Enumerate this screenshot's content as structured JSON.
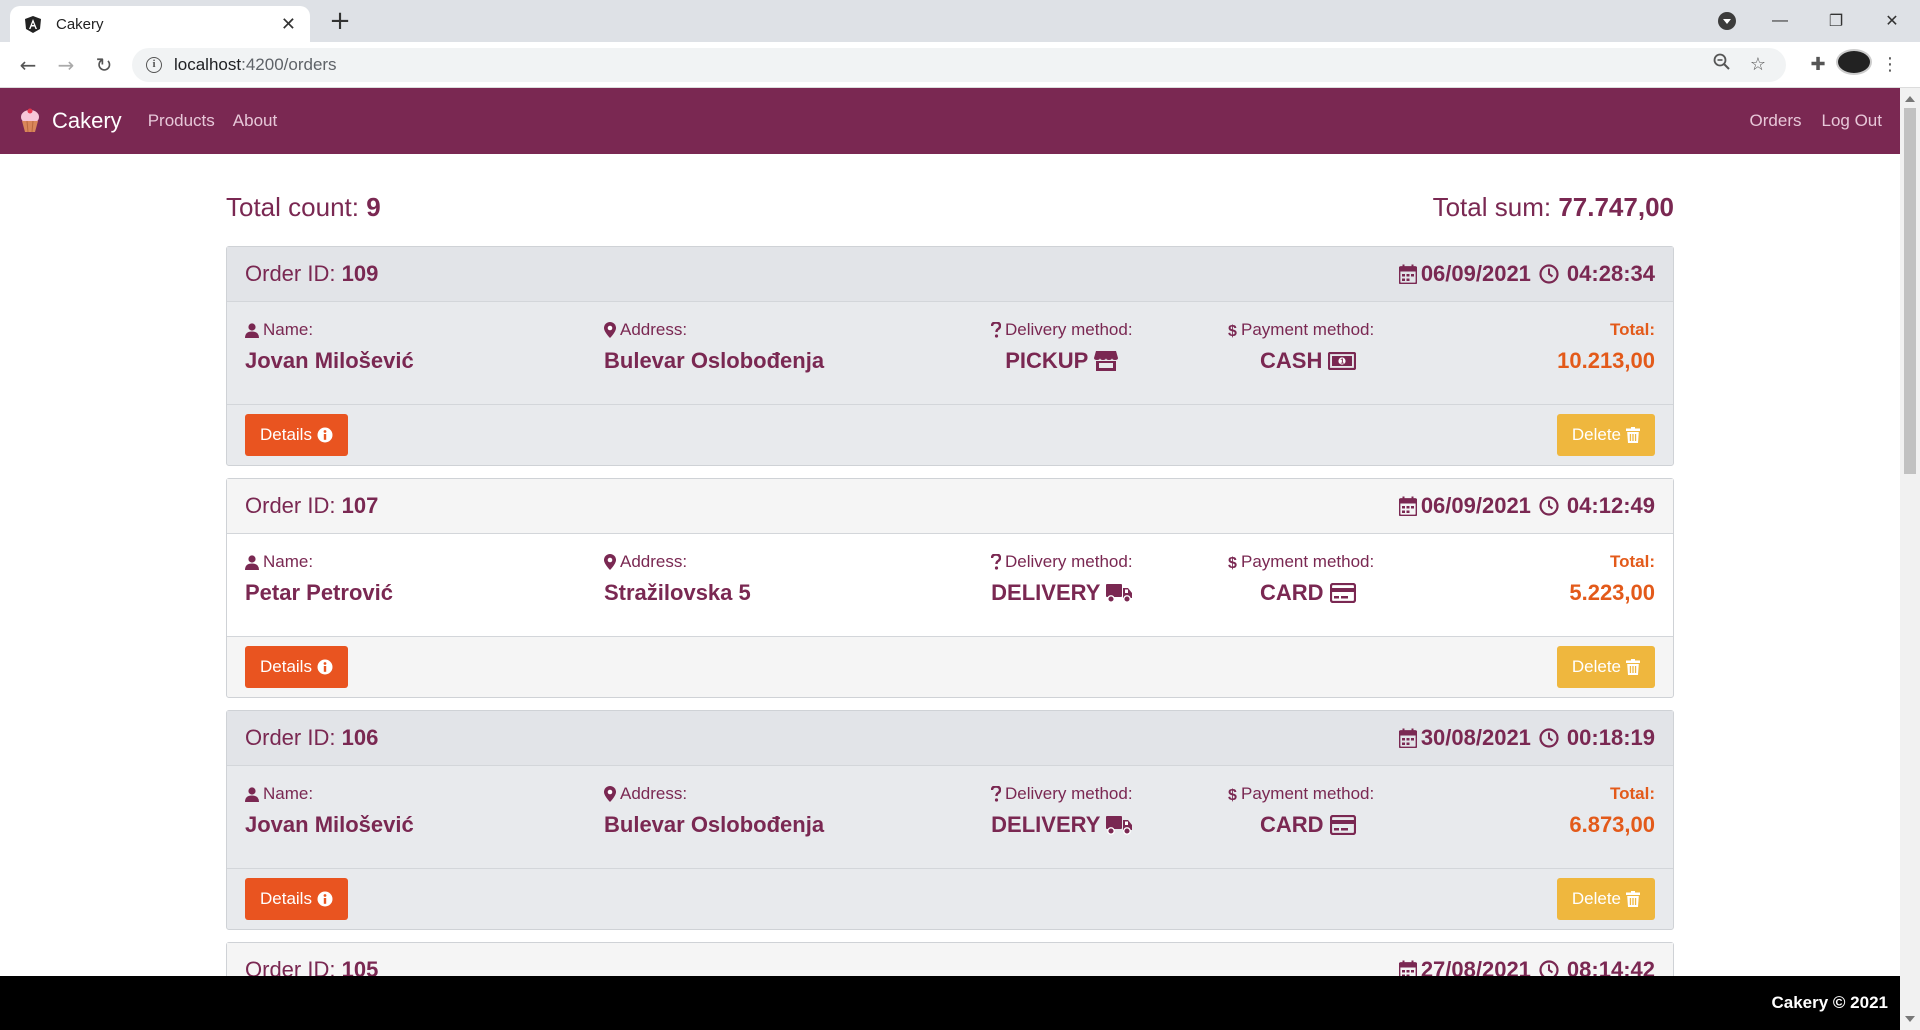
{
  "browser": {
    "tab_title": "Cakery",
    "url_host": "localhost",
    "url_rest": ":4200/orders",
    "new_tab": "+",
    "close": "✕"
  },
  "navbar": {
    "brand": "Cakery",
    "left_links": [
      "Products",
      "About"
    ],
    "right_links": [
      "Orders",
      "Log Out"
    ],
    "color": "#7a2852"
  },
  "summary": {
    "count_label": "Total count:",
    "count_value": "9",
    "sum_label": "Total sum:",
    "sum_value": "77.747,00"
  },
  "labels": {
    "order_id": "Order ID:",
    "name": "Name:",
    "address": "Address:",
    "delivery": "Delivery method:",
    "payment": "Payment method:",
    "total": "Total:",
    "details": "Details",
    "delete": "Delete"
  },
  "orders": [
    {
      "id": "109",
      "date": "06/09/2021",
      "time": "04:28:34",
      "name": "Jovan Milošević",
      "address": "Bulevar Oslobođenja",
      "delivery": "PICKUP",
      "delivery_icon": "store-icon",
      "payment": "CASH",
      "payment_icon": "money-bill-icon",
      "total": "10.213,00"
    },
    {
      "id": "107",
      "date": "06/09/2021",
      "time": "04:12:49",
      "name": "Petar Petrović",
      "address": "Stražilovska 5",
      "delivery": "DELIVERY",
      "delivery_icon": "truck-icon",
      "payment": "CARD",
      "payment_icon": "credit-card-icon",
      "total": "5.223,00"
    },
    {
      "id": "106",
      "date": "30/08/2021",
      "time": "00:18:19",
      "name": "Jovan Milošević",
      "address": "Bulevar Oslobođenja",
      "delivery": "DELIVERY",
      "delivery_icon": "truck-icon",
      "payment": "CARD",
      "payment_icon": "credit-card-icon",
      "total": "6.873,00"
    },
    {
      "id": "105",
      "date": "27/08/2021",
      "time": "08:14:42"
    }
  ],
  "footer": "Cakery © 2021",
  "colors": {
    "primary": "#7a2852",
    "orange": "#e95420",
    "warning": "#efb73e"
  }
}
